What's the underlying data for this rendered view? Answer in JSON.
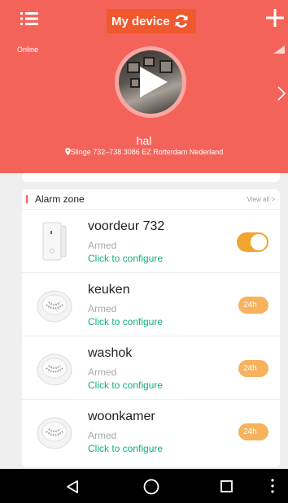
{
  "header": {
    "title": "My device",
    "status": "Online",
    "device_name": "hal",
    "address": "Slinge 732–738 3086 EZ Rotterdam Nederland",
    "color": "#f4635a"
  },
  "alarm_zone": {
    "title": "Alarm zone",
    "view_all": "View all >",
    "devices": [
      {
        "name": "voordeur 732",
        "state": "Armed",
        "action": "Click to configure",
        "type": "door-sensor",
        "control": "toggle-on"
      },
      {
        "name": "keuken",
        "state": "Armed",
        "action": "Click to configure",
        "type": "smoke-detector",
        "badge": "24h"
      },
      {
        "name": "washok",
        "state": "Armed",
        "action": "Click to configure",
        "type": "smoke-detector",
        "badge": "24h"
      },
      {
        "name": "woonkamer",
        "state": "Armed",
        "action": "Click to configure",
        "type": "smoke-detector",
        "badge": "24h"
      }
    ]
  },
  "colors": {
    "accent": "#f0a531",
    "badge": "#f6b25c",
    "configure": "#15b07a"
  },
  "icons": [
    "menu-icon",
    "refresh-icon",
    "plus-icon",
    "signal-icon",
    "play-icon",
    "chevron-right-icon",
    "location-pin-icon",
    "back-icon",
    "home-icon",
    "recent-apps-icon",
    "more-vertical-icon"
  ]
}
